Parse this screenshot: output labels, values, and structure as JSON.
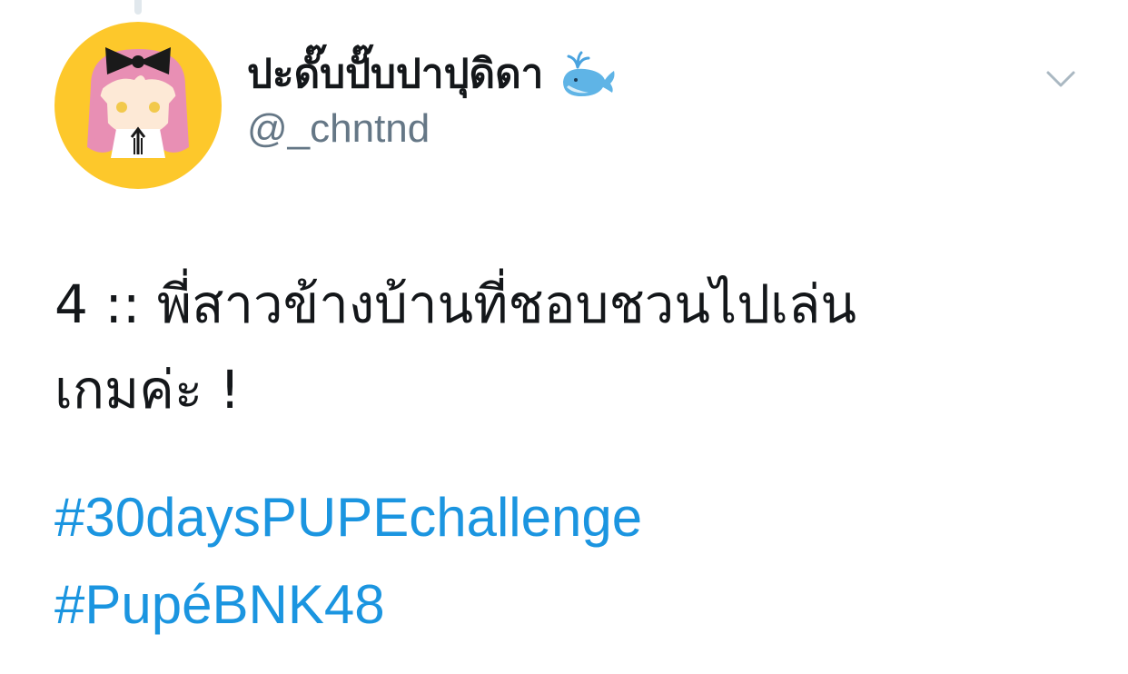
{
  "user": {
    "display_name": "ปะดั๊บปั๊บปาปุดิดา",
    "handle": "@_chntnd",
    "avatar_icon": "anime-girl-avatar-icon",
    "avatar_bg": "#fdc82b",
    "name_emoji_icon": "spouting-whale-icon"
  },
  "menu": {
    "icon": "chevron-down-icon"
  },
  "tweet": {
    "text_lines": [
      "4 ::  พี่สาวข้างบ้านที่ชอบชวนไปเล่น",
      "เกมค่ะ !"
    ],
    "hashtags": [
      "#30daysPUPEchallenge",
      "#PupéBNK48"
    ]
  },
  "colors": {
    "text": "#14171a",
    "secondary": "#657786",
    "link": "#1b95e0"
  }
}
